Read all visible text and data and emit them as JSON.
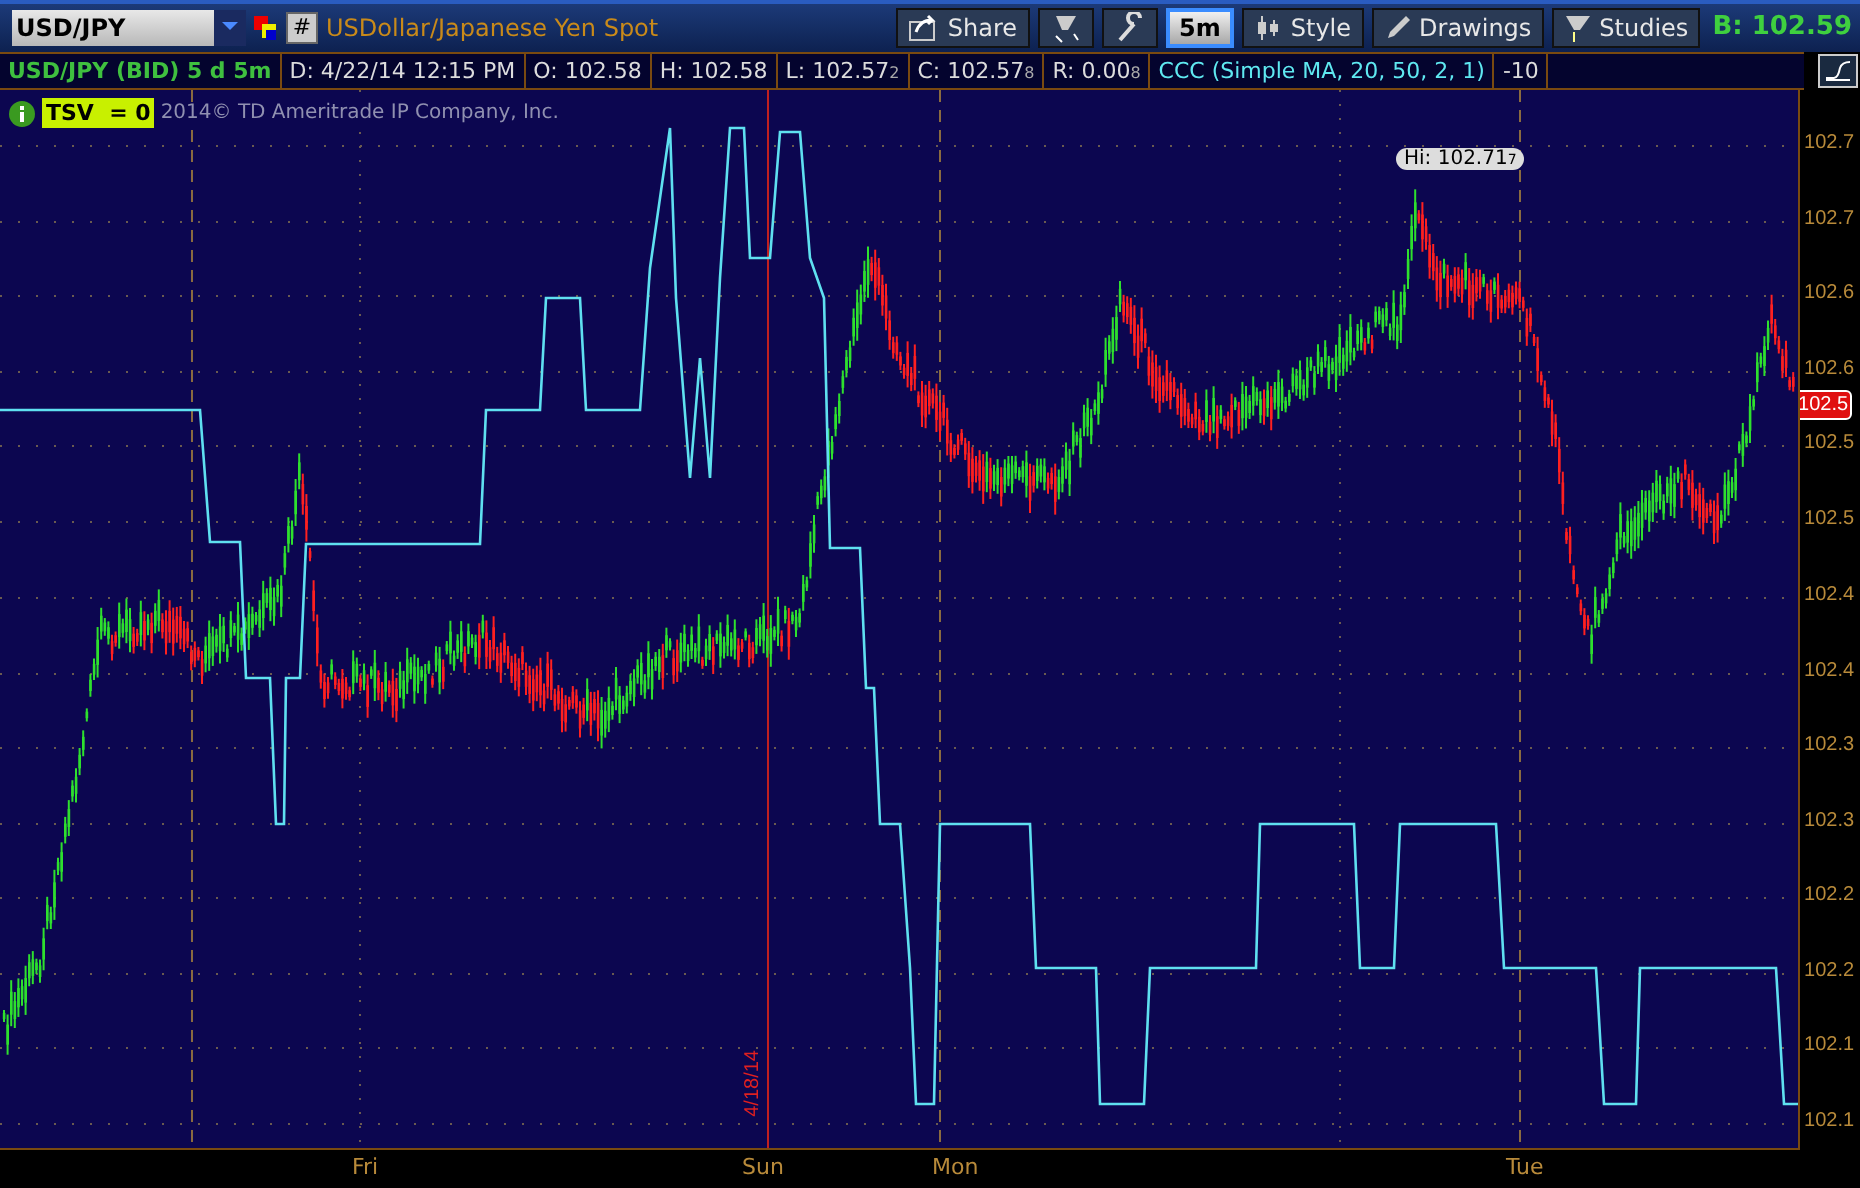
{
  "toolbar": {
    "symbol": "USD/JPY",
    "hash_button": "#",
    "description": "USDollar/Japanese Yen Spot",
    "buttons": [
      {
        "kind": "share",
        "label": "Share",
        "selected": false
      },
      {
        "kind": "flex-grid",
        "selected": false
      },
      {
        "kind": "wrench",
        "selected": false
      },
      {
        "kind": "period",
        "label": "5m",
        "selected": true
      },
      {
        "kind": "style",
        "label": "Style",
        "selected": false
      },
      {
        "kind": "drawings",
        "label": "Drawings",
        "selected": false
      },
      {
        "kind": "studies",
        "label": "Studies",
        "selected": false
      }
    ],
    "bid": "B: 102.59"
  },
  "info": [
    {
      "kind": "symbol",
      "text": "USD/JPY (BID) 5 d 5m"
    },
    {
      "kind": "plain",
      "text": "D: 4/22/14 12:15 PM"
    },
    {
      "kind": "plain",
      "text": "O: 102.58"
    },
    {
      "kind": "plain",
      "text": "H: 102.58"
    },
    {
      "kind": "plain",
      "text": "L: 102.57$_{2}$"
    },
    {
      "kind": "plain",
      "text": "C: 102.57$_{8}$"
    },
    {
      "kind": "plain",
      "text": "R: 0.00$_{8}$"
    },
    {
      "kind": "study",
      "text": "CCC (Simple MA, 20, 50, 2, 1)"
    },
    {
      "kind": "plain",
      "text": "-10"
    }
  ],
  "legend": {
    "study": "TSV  = 0",
    "copyright": "2014© TD Ameritrade IP Company, Inc."
  },
  "chart": {
    "high_label": "Hi: 102.71$_{7}$",
    "last_price": "102.5",
    "date_marker": "4/18/14",
    "y_labels": [
      "102.7",
      "102.7",
      "102.6",
      "102.6",
      "102.5",
      "102.5",
      "102.4",
      "102.4",
      "102.3",
      "102.3",
      "102.2",
      "102.2",
      "102.1",
      "102.1"
    ],
    "x_labels": [
      "Fri",
      "Sun",
      "Mon",
      "Tue"
    ]
  }
}
